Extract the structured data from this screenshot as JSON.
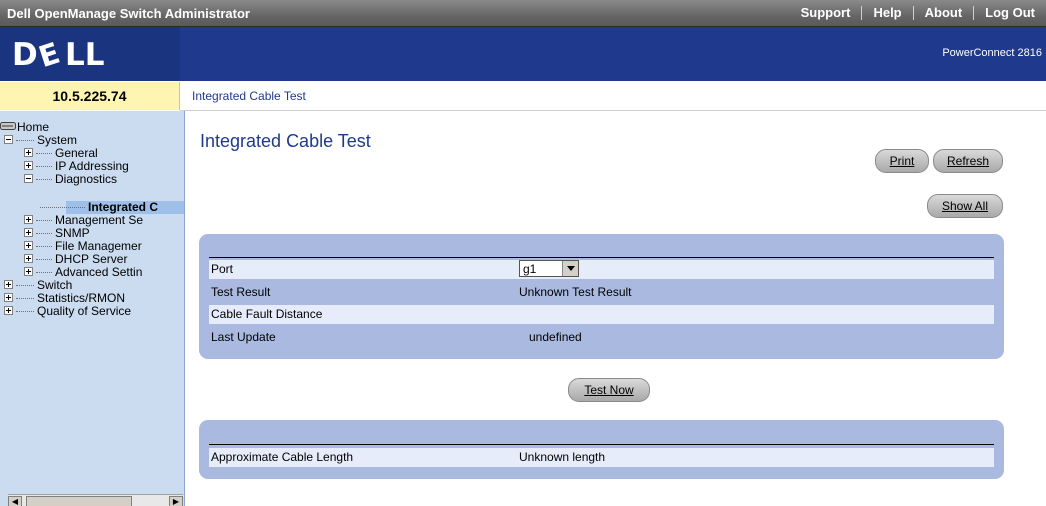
{
  "header": {
    "app_title": "Dell OpenManage Switch Administrator",
    "links": [
      "Support",
      "Help",
      "About",
      "Log Out"
    ]
  },
  "banner": {
    "logo_text": "DELL",
    "product": "PowerConnect 2816"
  },
  "ip_address": "10.5.225.74",
  "breadcrumb": "Integrated Cable Test",
  "tree": {
    "home": "Home",
    "system": "System",
    "general": "General",
    "ip_addressing": "IP Addressing",
    "diagnostics": "Diagnostics",
    "integrated": "Integrated C",
    "management": "Management Se",
    "snmp": "SNMP",
    "file_management": "File Managemer",
    "dhcp": "DHCP Server",
    "advanced": "Advanced Settin",
    "switch": "Switch",
    "statistics": "Statistics/RMON",
    "qos": "Quality of Service"
  },
  "main": {
    "title": "Integrated Cable Test",
    "print": "Print",
    "refresh": "Refresh",
    "show_all": "Show All",
    "test_now": "Test Now",
    "rows": [
      {
        "label": "Port",
        "value": "g1"
      },
      {
        "label": "Test Result",
        "value": "Unknown Test Result"
      },
      {
        "label": "Cable Fault Distance",
        "value": ""
      },
      {
        "label": "Last Update",
        "value": "undefined"
      }
    ],
    "length_label": "Approximate Cable Length",
    "length_value": "Unknown length"
  },
  "colors": {
    "banner": "#1f3a8c",
    "sidebar": "#cbdcf0",
    "panel": "#a9b9df",
    "ip_box": "#fff5b3"
  }
}
